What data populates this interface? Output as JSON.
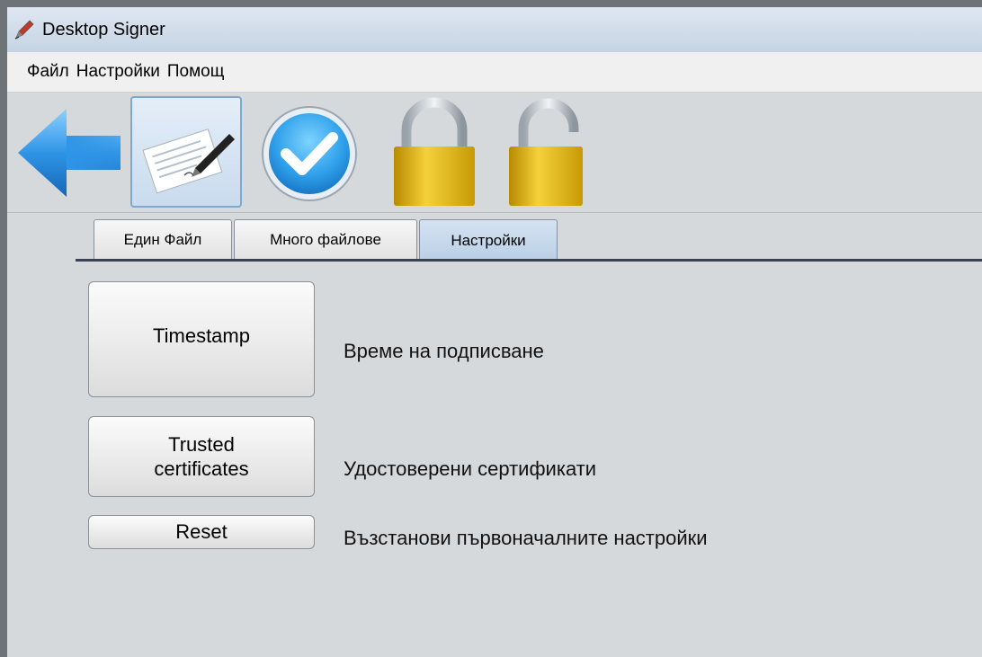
{
  "window": {
    "title": "Desktop Signer",
    "icon": "pen-icon"
  },
  "menu": {
    "items": [
      "Файл",
      "Настройки",
      "Помощ"
    ]
  },
  "toolbar": {
    "buttons": [
      {
        "name": "back",
        "icon": "arrow-left-icon"
      },
      {
        "name": "sign",
        "icon": "document-sign-icon",
        "selected": true
      },
      {
        "name": "verify",
        "icon": "checkmark-circle-icon"
      },
      {
        "name": "lock",
        "icon": "lock-closed-icon"
      },
      {
        "name": "unlock",
        "icon": "lock-open-icon"
      }
    ]
  },
  "tabs": {
    "items": [
      "Един Файл",
      "Много файлове",
      "Настройки"
    ],
    "active_index": 2
  },
  "settings": {
    "timestamp": {
      "button": "Timestamp",
      "description": "Време на подписване"
    },
    "trusted": {
      "button_line1": "Trusted",
      "button_line2": "certificates",
      "description": "Удостоверени сертификати"
    },
    "reset": {
      "button": "Reset",
      "description": "Възстанови първоначалните настройки"
    }
  },
  "colors": {
    "accent_blue": "#2f95e6",
    "lock_gold": "#e0b010",
    "tab_active": "#c4d7ec"
  }
}
